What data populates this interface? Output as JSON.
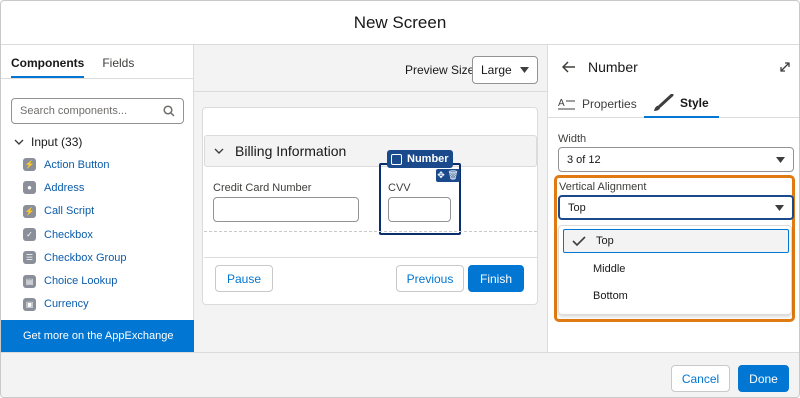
{
  "modal": {
    "title": "New Screen"
  },
  "left_panel": {
    "tabs": [
      {
        "label": "Components"
      },
      {
        "label": "Fields"
      }
    ],
    "search": {
      "placeholder": "Search components...",
      "value": ""
    },
    "group": {
      "label": "Input (33)"
    },
    "items": [
      {
        "label": "Action Button",
        "icon": "lightning-icon"
      },
      {
        "label": "Address",
        "icon": "location-pin-icon"
      },
      {
        "label": "Call Script",
        "icon": "lightning-icon"
      },
      {
        "label": "Checkbox",
        "icon": "checkbox-icon"
      },
      {
        "label": "Checkbox Group",
        "icon": "checkbox-group-icon"
      },
      {
        "label": "Choice Lookup",
        "icon": "lookup-icon"
      },
      {
        "label": "Currency",
        "icon": "currency-icon"
      }
    ],
    "appexchange": "Get more on the AppExchange"
  },
  "canvas": {
    "preview_label": "Preview Size",
    "preview_value": "Large",
    "section_title": "Billing Information",
    "fields": [
      {
        "label": "Credit Card Number"
      },
      {
        "label": "CVV"
      }
    ],
    "selected_badge": "Number",
    "buttons": {
      "pause": "Pause",
      "previous": "Previous",
      "finish": "Finish"
    }
  },
  "right_panel": {
    "title": "Number",
    "tabs": [
      {
        "label": "Properties"
      },
      {
        "label": "Style"
      }
    ],
    "width_label": "Width",
    "width_value": "3 of 12",
    "valign_label": "Vertical Alignment",
    "valign_value": "Top",
    "options": [
      {
        "label": "Top"
      },
      {
        "label": "Middle"
      },
      {
        "label": "Bottom"
      }
    ]
  },
  "footer": {
    "cancel": "Cancel",
    "done": "Done"
  },
  "colors": {
    "brand": "#0176d3",
    "highlight": "#e07a12",
    "selected_border": "#1b4a8c"
  }
}
